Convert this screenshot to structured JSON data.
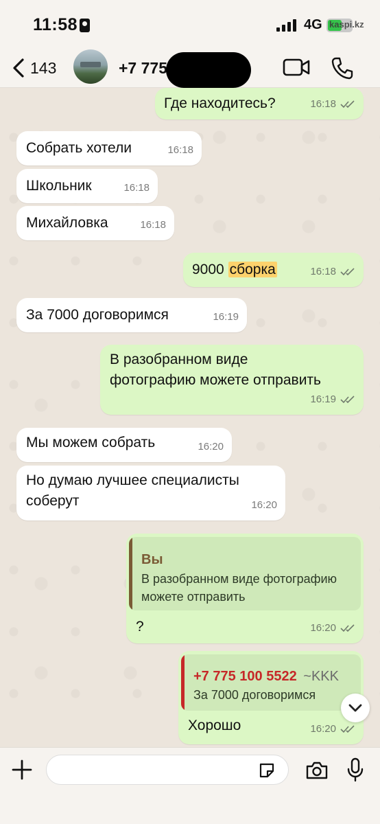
{
  "status_bar": {
    "time": "11:58",
    "network": "4G",
    "watermark": "kaspi.kz"
  },
  "header": {
    "back_count": "143",
    "contact_name": "+7 775"
  },
  "messages": [
    {
      "direction": "out",
      "text": "Где находитесь?",
      "time": "16:18"
    },
    {
      "direction": "in",
      "text": "Собрать хотели",
      "time": "16:18"
    },
    {
      "direction": "in",
      "text": "Школьник",
      "time": "16:18"
    },
    {
      "direction": "in",
      "text": "Михайловка",
      "time": "16:18"
    },
    {
      "direction": "out",
      "text_plain": "9000",
      "text_highlight": "сборка",
      "time": "16:18"
    },
    {
      "direction": "in",
      "text": "За 7000 договоримся",
      "time": "16:19"
    },
    {
      "direction": "out",
      "line1": "В разобранном виде",
      "line2": "фотографию можете отправить",
      "time": "16:19"
    },
    {
      "direction": "in",
      "text": "Мы можем собрать",
      "time": "16:20"
    },
    {
      "direction": "in",
      "line1": "Но думаю лучшее специалисты",
      "line2": "соберут",
      "time": "16:20"
    },
    {
      "direction": "out",
      "quote_author": "Вы",
      "quote_line1": "В разобранном виде фотографию",
      "quote_line2": "можете отправить",
      "text": "?",
      "time": "16:20"
    },
    {
      "direction": "out",
      "quote_author": "+7 775 100 5522",
      "quote_alias": "~KKK",
      "quote_text": "За 7000 договоримся",
      "text": "Хорошо",
      "time": "16:20"
    }
  ],
  "colors": {
    "outgoing": "#dcf7c5",
    "incoming": "#ffffff",
    "quote_self": "#7a5a35",
    "quote_other": "#c62828",
    "highlight": "#fcd26c"
  },
  "input": {
    "placeholder": ""
  }
}
